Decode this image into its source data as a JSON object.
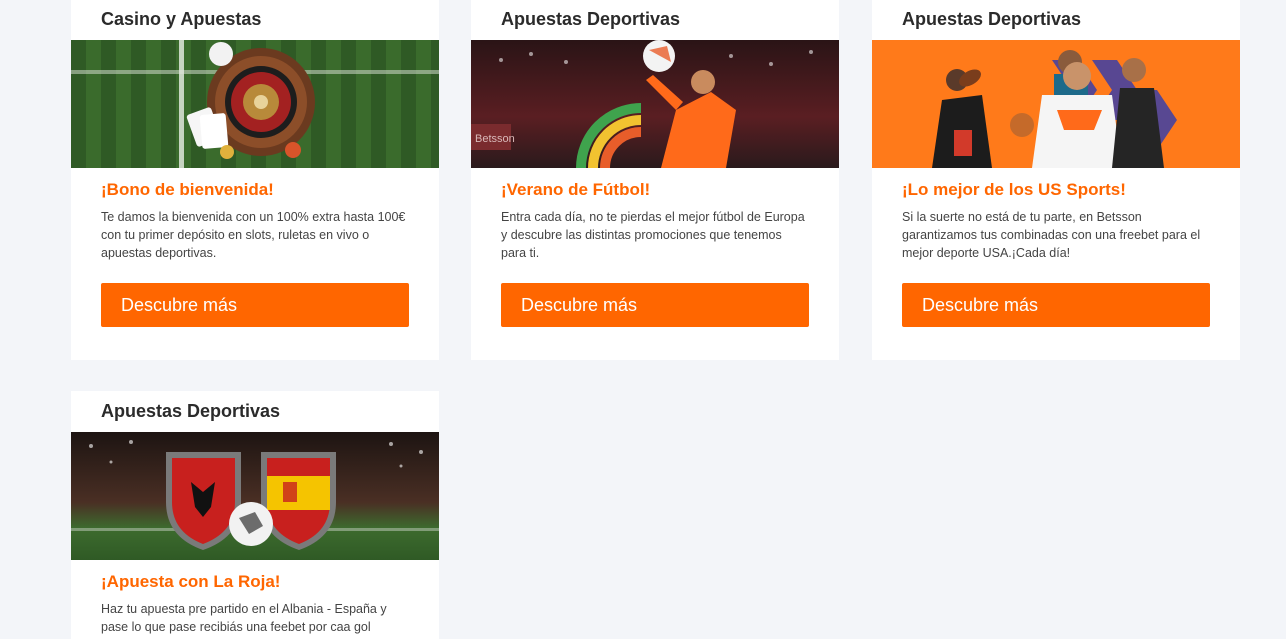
{
  "promotions": [
    {
      "category": "Casino y Apuestas",
      "headline": "¡Bono de bienvenida!",
      "body": "Te damos la bienvenida con un 100% extra hasta 100€ con tu primer depósito en slots, ruletas en vivo o apuestas deportivas.",
      "cta": "Descubre más"
    },
    {
      "category": "Apuestas Deportivas",
      "headline": "¡Verano de Fútbol!",
      "body": "Entra cada día, no te pierdas el mejor fútbol de Europa y descubre las distintas promociones que tenemos para ti.",
      "cta": "Descubre más"
    },
    {
      "category": "Apuestas Deportivas",
      "headline": "¡Lo mejor de los US Sports!",
      "body": "Si la suerte no está de tu parte, en Betsson garantizamos tus combinadas con una freebet para el mejor deporte USA.¡Cada día!",
      "cta": "Descubre más"
    },
    {
      "category": "Apuestas Deportivas",
      "headline": "¡Apuesta con La Roja!",
      "body": "Haz tu apuesta pre partido en el Albania - España y pase lo que pase recibiás una feebet por caa gol"
    }
  ],
  "images": {
    "brand_text": "Betsson"
  },
  "colors": {
    "accent": "#ff6600",
    "page_background": "#f3f5f9",
    "card_background": "#ffffff",
    "title_text": "#2b2b2b"
  }
}
